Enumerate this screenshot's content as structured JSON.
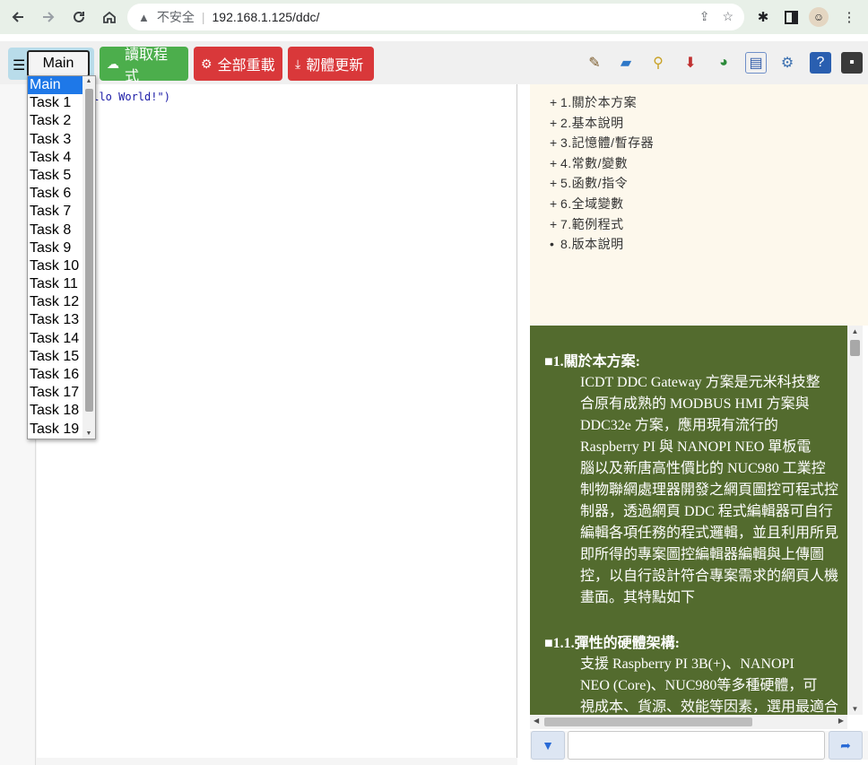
{
  "browser": {
    "back_icon": "arrow-left-icon",
    "forward_icon": "arrow-right-icon",
    "reload_icon": "reload-icon",
    "home_icon": "home-icon",
    "security_label": "不安全",
    "url": "192.168.1.125/ddc/"
  },
  "toolbar": {
    "task_select_value": "Main",
    "read_program_label": "讀取程式",
    "reload_all_label": "全部重載",
    "firmware_update_label": "韌體更新",
    "colors": {
      "green": "#4cae4c",
      "red": "#d9383a",
      "toggle_bg": "#b9dcea"
    }
  },
  "editor": {
    "code_prefix": "ello World!\")"
  },
  "dropdown": {
    "items": [
      "Main",
      "Task 1",
      "Task 2",
      "Task 3",
      "Task 4",
      "Task 5",
      "Task 6",
      "Task 7",
      "Task 8",
      "Task 9",
      "Task 10",
      "Task 11",
      "Task 12",
      "Task 13",
      "Task 14",
      "Task 15",
      "Task 16",
      "Task 17",
      "Task 18",
      "Task 19"
    ],
    "selected": "Main"
  },
  "toc": {
    "items": [
      {
        "mark": "+",
        "label": "1.關於本方案"
      },
      {
        "mark": "+",
        "label": "2.基本說明"
      },
      {
        "mark": "+",
        "label": "3.記憶體/暫存器"
      },
      {
        "mark": "+",
        "label": "4.常數/變數"
      },
      {
        "mark": "+",
        "label": "5.函數/指令"
      },
      {
        "mark": "+",
        "label": "6.全域變數"
      },
      {
        "mark": "+",
        "label": "7.範例程式"
      },
      {
        "mark": "•",
        "label": "8.版本說明"
      }
    ]
  },
  "doc": {
    "background": "#536b2e",
    "sec1_title": "■1.關於本方案:",
    "sec1_lines": [
      "ICDT DDC Gateway 方案是元米科技整",
      "合原有成熟的 MODBUS HMI 方案與",
      "DDC32e 方案，應用現有流行的",
      "Raspberry PI 與 NANOPI NEO 單板電",
      "腦以及新唐高性價比的 NUC980 工業控",
      "制物聯網處理器開發之網頁圖控可程式控",
      "制器，透過網頁 DDC 程式編輯器可自行",
      "編輯各項任務的程式邏輯，並且利用所見",
      "即所得的專案圖控編輯器編輯與上傳圖",
      "控，以自行設計符合專案需求的網頁人機",
      "畫面。其特點如下"
    ],
    "sec11_title": "■1.1.彈性的硬體架構:",
    "sec11_lines": [
      "支援 Raspberry PI 3B(+)、NANOPI",
      "NEO (Core)、NUC980等多種硬體，可",
      "視成本、貨源、效能等因素，選用最適合"
    ]
  },
  "command": {
    "input_value": "",
    "down_icon": "triangle-down-icon",
    "send_icon": "share-arrow-icon"
  }
}
